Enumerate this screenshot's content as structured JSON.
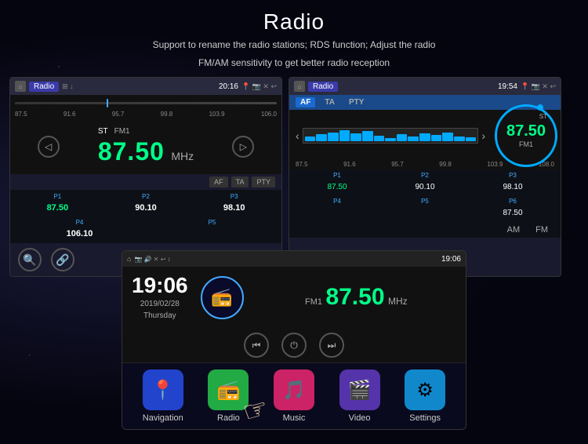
{
  "page": {
    "title": "Radio",
    "subtitle_line1": "Support to rename the radio stations; RDS function; Adjust the radio",
    "subtitle_line2": "FM/AM sensitivity to get better radio reception"
  },
  "screen_left": {
    "header": {
      "home": "⌂",
      "app_name": "Radio",
      "icons_label": "⊞ ↓",
      "time": "20:16",
      "status_icons": "📍 📷 ✕ ↩"
    },
    "freq_labels": [
      "87.5",
      "91.6",
      "95.7",
      "99.8",
      "103.9",
      "106.0"
    ],
    "st_label": "ST",
    "fm_label": "FM1",
    "main_freq": "87.50",
    "freq_unit": "MHz",
    "af_btn": "AF",
    "ta_btn": "TA",
    "pty_btn": "PTY",
    "presets_row1": [
      {
        "label": "P1",
        "freq": "87.50",
        "active": true
      },
      {
        "label": "P2",
        "freq": "90.10",
        "active": false
      },
      {
        "label": "P3",
        "freq": "98.10",
        "active": false
      }
    ],
    "presets_row2": [
      {
        "label": "P4",
        "freq": "106.10",
        "active": false
      },
      {
        "label": "P5",
        "freq": "",
        "active": false
      }
    ],
    "search_icon": "🔍",
    "link_icon": "🔗"
  },
  "screen_right": {
    "header": {
      "home": "⌂",
      "app_name": "Radio",
      "time": "19:54",
      "status_icons": "📍 📷 ✕ ↩"
    },
    "af_btn": "AF",
    "ta_btn": "TA",
    "pty_btn": "PTY",
    "freq_labels": [
      "87.5",
      "91.6",
      "95.7",
      "99.8",
      "103.9",
      "108.0"
    ],
    "st_label": "ST",
    "main_freq": "87.50",
    "fm_label": "FM1",
    "presets_row1": [
      {
        "label": "P1",
        "freq": "87.50",
        "active": true
      },
      {
        "label": "P2",
        "freq": "90.10",
        "active": false
      },
      {
        "label": "P3",
        "freq": "98.10",
        "active": false
      }
    ],
    "presets_row2": [
      {
        "label": "P4",
        "freq": "",
        "active": false
      },
      {
        "label": "P5",
        "freq": "",
        "active": false
      },
      {
        "label": "P6",
        "freq": "87.50",
        "active": false
      }
    ],
    "am_label": "AM",
    "fm_tab": "FM"
  },
  "overlay": {
    "header": {
      "home": "⌂",
      "app_name": "",
      "time": "19:06",
      "status_icons": "📷 🔊 ✕ ↩ ↕"
    },
    "time": "19:06",
    "date": "2019/02/28",
    "day": "Thursday",
    "radio_icon": "📻",
    "fm_label": "FM1",
    "main_freq": "87.50",
    "freq_unit": "MHz",
    "prev_btn": "⏮",
    "power_btn": "⏻",
    "next_btn": "⏭"
  },
  "apps": [
    {
      "label": "Navigation",
      "icon": "📍",
      "color_class": "nav-app"
    },
    {
      "label": "Radio",
      "icon": "📻",
      "color_class": "radio-app"
    },
    {
      "label": "Music",
      "icon": "🎵",
      "color_class": "music-app"
    },
    {
      "label": "Video",
      "icon": "🎬",
      "color_class": "video-app"
    },
    {
      "label": "Settings",
      "icon": "⚙",
      "color_class": "settings-app"
    }
  ]
}
